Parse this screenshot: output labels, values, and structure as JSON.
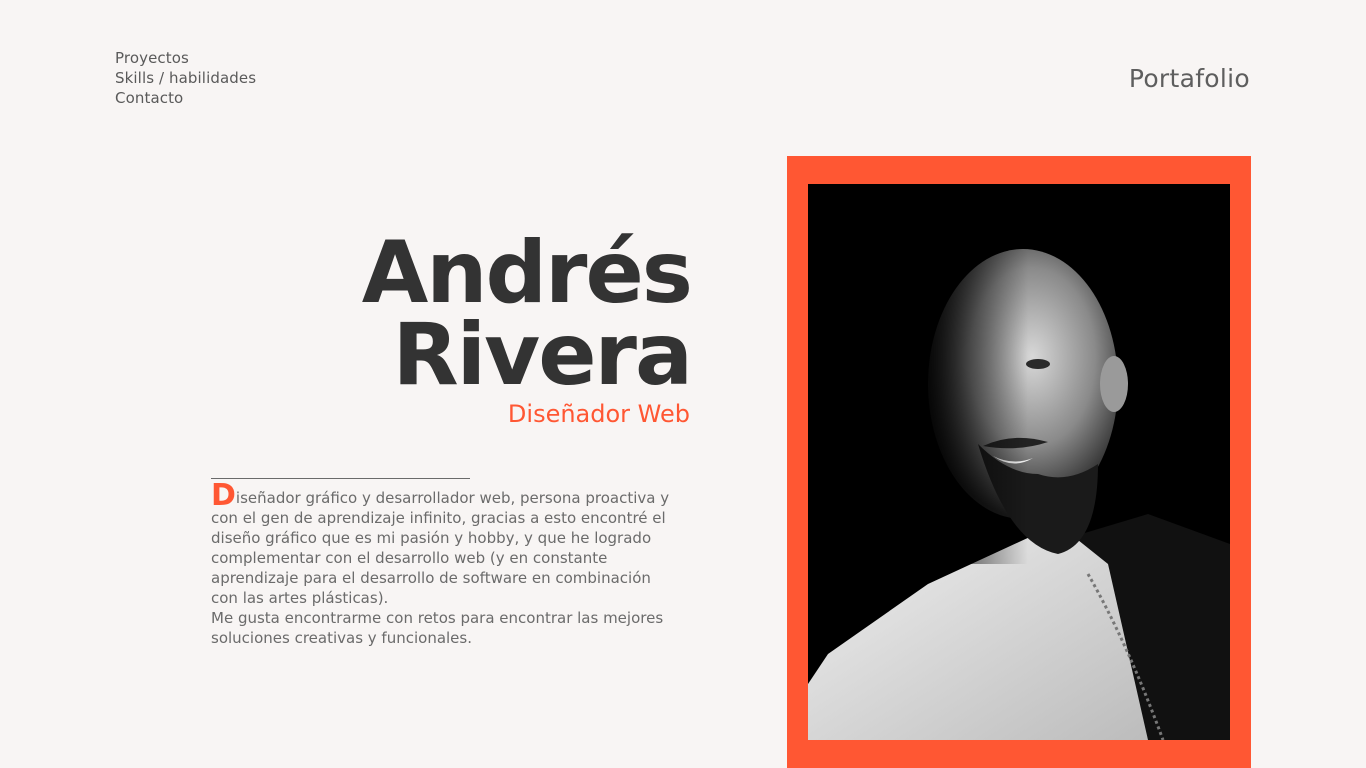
{
  "nav": {
    "items": [
      "Proyectos",
      "Skills / habilidades",
      "Contacto"
    ]
  },
  "brand": "Portafolio",
  "hero": {
    "first_name": "Andrés",
    "last_name": "Rivera",
    "role": "Diseñador Web"
  },
  "bio": {
    "drop_cap": "D",
    "paragraph1_rest": "iseñador gráfico y desarrollador web, persona proactiva y con el gen de aprendizaje infinito, gracias a esto encontré el diseño gráfico que es mi pasión y hobby, y que he logrado complementar con el desarrollo web (y en constante aprendizaje para el desarrollo de software en combinación con las artes plásticas).",
    "paragraph2": "Me gusta encontrarme con retos para encontrar las mejores soluciones creativas y funcionales."
  },
  "colors": {
    "accent": "#ff5733",
    "background": "#f8f5f4",
    "heading": "#333333",
    "text": "#6b6b6b"
  },
  "photo": {
    "icon": "portrait-photo"
  }
}
